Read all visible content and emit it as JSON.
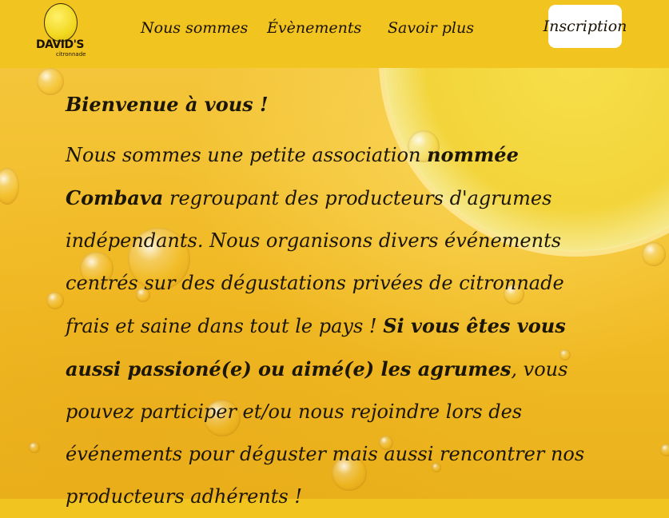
{
  "logo": {
    "name": "DAVID'S",
    "subtitle": "citronnade"
  },
  "nav": {
    "links": [
      "Nous sommes",
      "Évènements",
      "Savoir plus"
    ],
    "signup_label": "Inscription"
  },
  "main": {
    "welcome": "Bienvenue à vous !",
    "paragraph": [
      {
        "text": "Nous sommes une petite association ",
        "bold": false
      },
      {
        "text": "nommée Combava",
        "bold": true
      },
      {
        "text": " regroupant des producteurs d'agrumes indépendants. Nous organisons divers événements centrés sur des dégustations privées de citronnade frais et saine dans tout le pays ! ",
        "bold": false
      },
      {
        "text": "Si vous êtes vous aussi passioné(e) ou aimé(e) les agrumes",
        "bold": true
      },
      {
        "text": ", vous pouvez participer et/ou nous rejoindre lors des événements pour déguster mais aussi rencontrer nos producteurs adhérents !",
        "bold": false
      }
    ]
  },
  "colors": {
    "nav_bg": "#f1c41f",
    "text": "#1c1606",
    "button_bg": "#ffffff"
  }
}
